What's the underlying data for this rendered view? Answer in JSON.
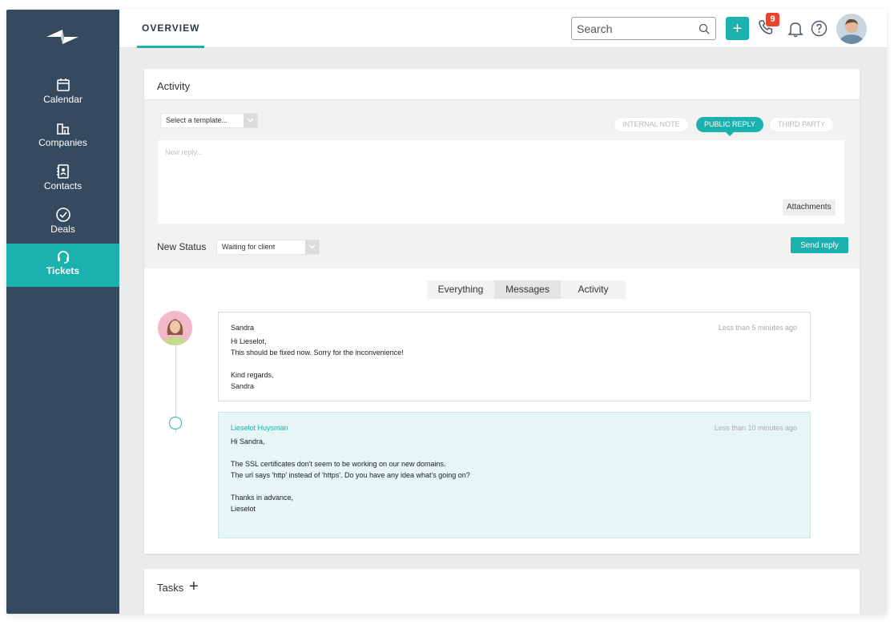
{
  "sidebar": {
    "items": [
      {
        "label": "Calendar",
        "icon": "calendar-icon"
      },
      {
        "label": "Companies",
        "icon": "companies-icon"
      },
      {
        "label": "Contacts",
        "icon": "contacts-icon"
      },
      {
        "label": "Deals",
        "icon": "deals-icon"
      },
      {
        "label": "Tickets",
        "icon": "headset-icon",
        "active": true
      }
    ]
  },
  "topbar": {
    "tab": "OVERVIEW",
    "search_placeholder": "Search",
    "add_label": "+",
    "notification_count": "9"
  },
  "activity": {
    "title": "Activity",
    "template_select": "Select a template...",
    "reply_types": [
      "INTERNAL NOTE",
      "PUBLIC REPLY",
      "THIRD PARTY"
    ],
    "active_reply_type": "PUBLIC REPLY",
    "reply_placeholder": "New reply...",
    "attachments_label": "Attachments",
    "status_label": "New Status",
    "status_value": "Waiting for client",
    "send_label": "Send reply",
    "filters": [
      "Everything",
      "Messages",
      "Activity"
    ],
    "active_filter": "Messages",
    "messages": [
      {
        "author": "Sandra",
        "time": "Less than 5 minutes ago",
        "body": "Hi Lieselot,\nThis should be fixed now. Sorry for the inconvenience!\n\nKind regards,\nSandra"
      },
      {
        "author": "Lieselot Huysman",
        "time": "Less than 10 minutes ago",
        "body": "Hi Sandra,\n\nThe SSL certificates don't seem to be working on our new domains.\nThe url says 'http' instead of 'https'. Do you have any idea what's going on?\n\nThanks in advance,\nLieselot"
      }
    ]
  },
  "tasks": {
    "title": "Tasks",
    "add_label": "+"
  },
  "colors": {
    "sidebar": "#354a5f",
    "accent": "#1bb1ad",
    "badge": "#e8452c"
  }
}
